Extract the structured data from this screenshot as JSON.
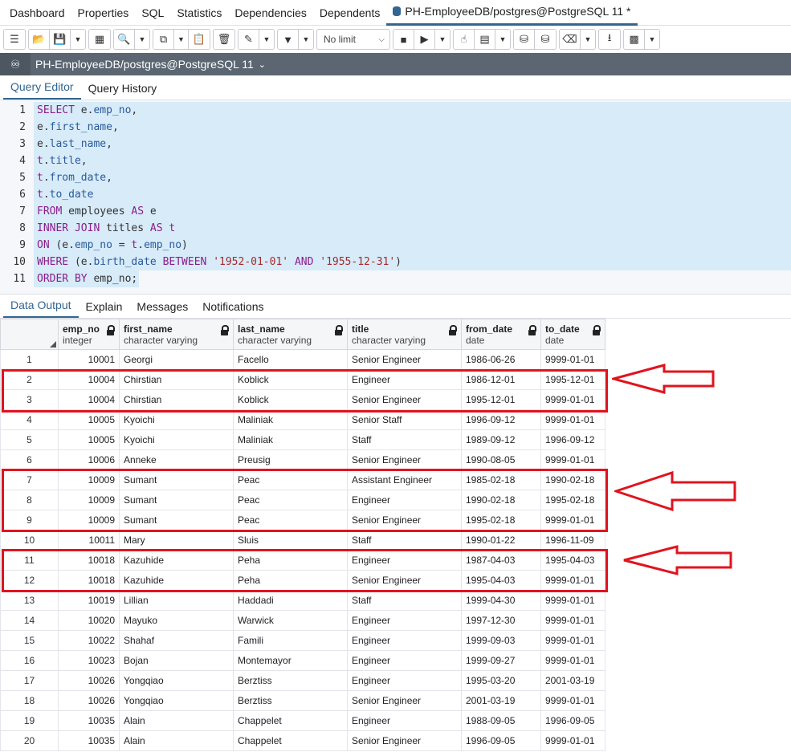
{
  "top_tabs": [
    "Dashboard",
    "Properties",
    "SQL",
    "Statistics",
    "Dependencies",
    "Dependents"
  ],
  "active_tab": "PH-EmployeeDB/postgres@PostgreSQL 11 *",
  "toolbar": {
    "limit": "No limit"
  },
  "connection": "PH-EmployeeDB/postgres@PostgreSQL 11",
  "editor_tabs": [
    "Query Editor",
    "Query History"
  ],
  "output_tabs": [
    "Data Output",
    "Explain",
    "Messages",
    "Notifications"
  ],
  "columns": [
    {
      "name": "emp_no",
      "type": "integer"
    },
    {
      "name": "first_name",
      "type": "character varying"
    },
    {
      "name": "last_name",
      "type": "character varying"
    },
    {
      "name": "title",
      "type": "character varying"
    },
    {
      "name": "from_date",
      "type": "date"
    },
    {
      "name": "to_date",
      "type": "date"
    }
  ],
  "rows": [
    [
      "1",
      "10001",
      "Georgi",
      "Facello",
      "Senior Engineer",
      "1986-06-26",
      "9999-01-01"
    ],
    [
      "2",
      "10004",
      "Chirstian",
      "Koblick",
      "Engineer",
      "1986-12-01",
      "1995-12-01"
    ],
    [
      "3",
      "10004",
      "Chirstian",
      "Koblick",
      "Senior Engineer",
      "1995-12-01",
      "9999-01-01"
    ],
    [
      "4",
      "10005",
      "Kyoichi",
      "Maliniak",
      "Senior Staff",
      "1996-09-12",
      "9999-01-01"
    ],
    [
      "5",
      "10005",
      "Kyoichi",
      "Maliniak",
      "Staff",
      "1989-09-12",
      "1996-09-12"
    ],
    [
      "6",
      "10006",
      "Anneke",
      "Preusig",
      "Senior Engineer",
      "1990-08-05",
      "9999-01-01"
    ],
    [
      "7",
      "10009",
      "Sumant",
      "Peac",
      "Assistant Engineer",
      "1985-02-18",
      "1990-02-18"
    ],
    [
      "8",
      "10009",
      "Sumant",
      "Peac",
      "Engineer",
      "1990-02-18",
      "1995-02-18"
    ],
    [
      "9",
      "10009",
      "Sumant",
      "Peac",
      "Senior Engineer",
      "1995-02-18",
      "9999-01-01"
    ],
    [
      "10",
      "10011",
      "Mary",
      "Sluis",
      "Staff",
      "1990-01-22",
      "1996-11-09"
    ],
    [
      "11",
      "10018",
      "Kazuhide",
      "Peha",
      "Engineer",
      "1987-04-03",
      "1995-04-03"
    ],
    [
      "12",
      "10018",
      "Kazuhide",
      "Peha",
      "Senior Engineer",
      "1995-04-03",
      "9999-01-01"
    ],
    [
      "13",
      "10019",
      "Lillian",
      "Haddadi",
      "Staff",
      "1999-04-30",
      "9999-01-01"
    ],
    [
      "14",
      "10020",
      "Mayuko",
      "Warwick",
      "Engineer",
      "1997-12-30",
      "9999-01-01"
    ],
    [
      "15",
      "10022",
      "Shahaf",
      "Famili",
      "Engineer",
      "1999-09-03",
      "9999-01-01"
    ],
    [
      "16",
      "10023",
      "Bojan",
      "Montemayor",
      "Engineer",
      "1999-09-27",
      "9999-01-01"
    ],
    [
      "17",
      "10026",
      "Yongqiao",
      "Berztiss",
      "Engineer",
      "1995-03-20",
      "2001-03-19"
    ],
    [
      "18",
      "10026",
      "Yongqiao",
      "Berztiss",
      "Senior Engineer",
      "2001-03-19",
      "9999-01-01"
    ],
    [
      "19",
      "10035",
      "Alain",
      "Chappelet",
      "Engineer",
      "1988-09-05",
      "1996-09-05"
    ],
    [
      "20",
      "10035",
      "Alain",
      "Chappelet",
      "Senior Engineer",
      "1996-09-05",
      "9999-01-01"
    ]
  ],
  "highlight_color": "#e0141e"
}
